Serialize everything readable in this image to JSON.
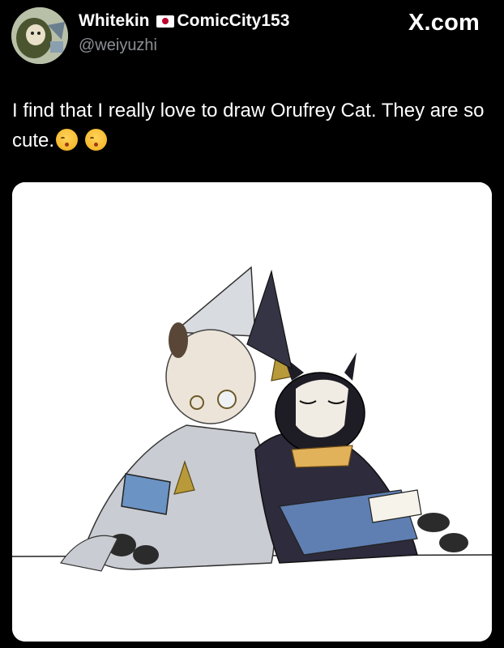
{
  "author": {
    "display_name": "Whitekin",
    "flag": "japan-flag-icon",
    "tag": "ComicCity153",
    "handle": "@weiyuzhi"
  },
  "site": "X.com",
  "tweet": {
    "text_line": "I find that I really love to draw Orufrey Cat. They are so  cute.",
    "emojis": [
      "kissing-face-with-closed-eyes",
      "kissing-face-with-closed-eyes"
    ]
  },
  "media": {
    "type": "illustration",
    "subject": "two cats in wizard robes and hats leaning together, one reading a book"
  },
  "colors": {
    "background": "#000000",
    "text": "#ffffff",
    "handle": "#8b8f94",
    "media_bg": "#ffffff"
  }
}
